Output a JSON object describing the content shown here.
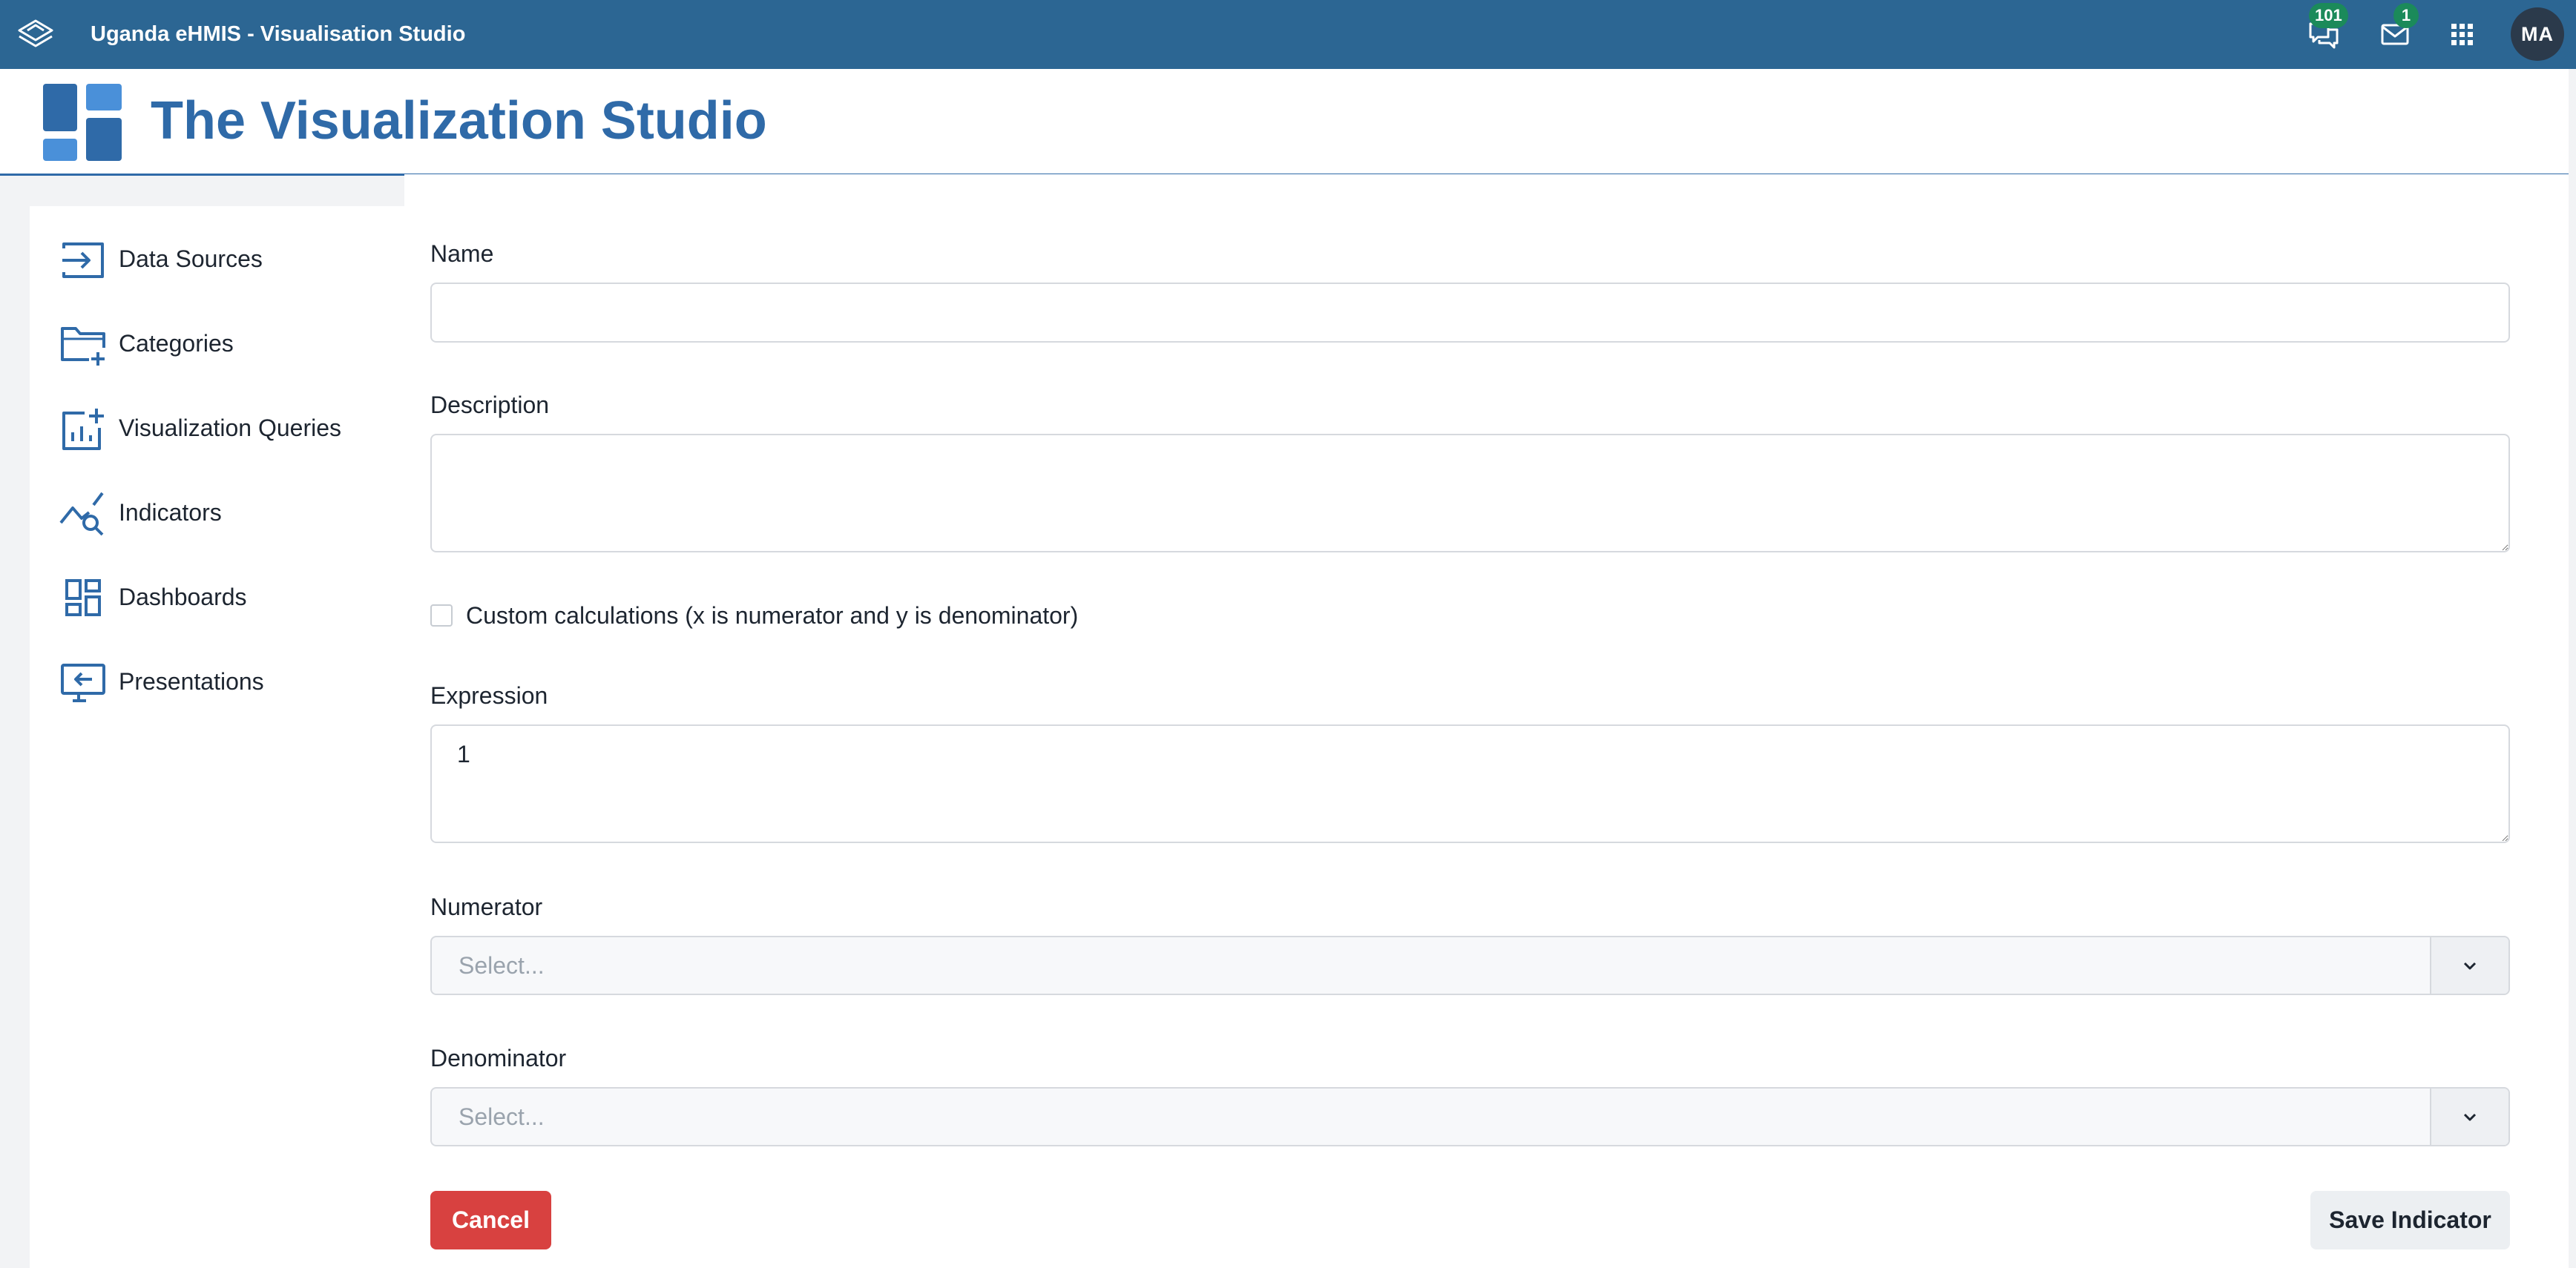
{
  "topbar": {
    "app_title": "Uganda eHMIS - Visualisation Studio",
    "logo_icon": "dhis2-layers-icon",
    "interpretations_icon": "chat-bubbles-icon",
    "interpretations_count": "101",
    "messages_icon": "envelope-icon",
    "messages_count": "1",
    "apps_icon": "apps-grid-icon",
    "user_initials": "MA",
    "bar_color": "#2c6693",
    "badge_color": "#1b8a5a"
  },
  "header": {
    "title": "The Visualization Studio",
    "logo_icon": "dashboard-tiles-icon",
    "accent_color": "#2f6aa8"
  },
  "sidebar": {
    "items": [
      {
        "label": "Data Sources",
        "icon": "input-arrow-icon"
      },
      {
        "label": "Categories",
        "icon": "folder-add-icon"
      },
      {
        "label": "Visualization Queries",
        "icon": "chart-add-icon"
      },
      {
        "label": "Indicators",
        "icon": "trend-search-icon"
      },
      {
        "label": "Dashboards",
        "icon": "dashboard-layout-icon"
      },
      {
        "label": "Presentations",
        "icon": "presentation-screen-icon"
      }
    ]
  },
  "form": {
    "name_label": "Name",
    "name_value": "",
    "description_label": "Description",
    "description_value": "",
    "custom_calc_label": "Custom calculations (x is numerator and y is denominator)",
    "custom_calc_checked": false,
    "expression_label": "Expression",
    "expression_value": "1",
    "numerator_label": "Numerator",
    "numerator_placeholder": "Select...",
    "denominator_label": "Denominator",
    "denominator_placeholder": "Select...",
    "cancel_label": "Cancel",
    "save_label": "Save Indicator",
    "cancel_color": "#d84140"
  }
}
